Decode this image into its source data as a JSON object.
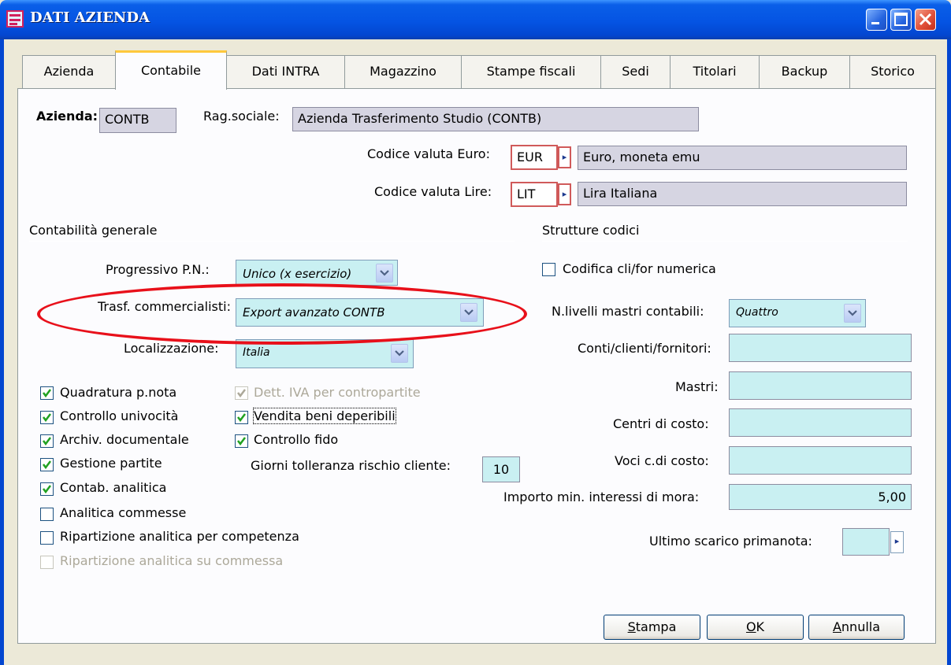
{
  "window": {
    "title": "DATI AZIENDA",
    "controls": {
      "minimize": "minimize-icon",
      "maximize": "maximize-icon",
      "close": "close-icon"
    }
  },
  "tabs": [
    "Azienda",
    "Contabile",
    "Dati INTRA",
    "Magazzino",
    "Stampe fiscali",
    "Sedi",
    "Titolari",
    "Backup",
    "Storico"
  ],
  "active_tab": "Contabile",
  "header": {
    "azienda_label": "Azienda:",
    "azienda_value": "CONTB",
    "rag_label": "Rag.sociale:",
    "rag_value": "Azienda Trasferimento Studio (CONTB)",
    "valuta_euro_label": "Codice valuta Euro:",
    "valuta_euro_code": "EUR",
    "valuta_euro_desc": "Euro, moneta emu",
    "valuta_lire_label": "Codice valuta Lire:",
    "valuta_lire_code": "LIT",
    "valuta_lire_desc": "Lira Italiana"
  },
  "contabilita": {
    "section_title": "Contabilità generale",
    "progressivo_label": "Progressivo P.N.:",
    "progressivo_value": "Unico (x esercizio)",
    "trasf_label": "Trasf. commercialisti:",
    "trasf_value": "Export avanzato CONTB",
    "localizzazione_label": "Localizzazione:",
    "localizzazione_value": "Italia",
    "checkboxes": [
      {
        "label": "Quadratura p.nota",
        "checked": true,
        "enabled": true
      },
      {
        "label": "Controllo univocità",
        "checked": true,
        "enabled": true
      },
      {
        "label": "Archiv. documentale",
        "checked": true,
        "enabled": true
      },
      {
        "label": "Gestione partite",
        "checked": true,
        "enabled": true
      },
      {
        "label": "Contab. analitica",
        "checked": true,
        "enabled": true
      },
      {
        "label": "Analitica commesse",
        "checked": false,
        "enabled": true
      },
      {
        "label": "Ripartizione analitica per competenza",
        "checked": false,
        "enabled": true
      },
      {
        "label": "Ripartizione analitica su commessa",
        "checked": false,
        "enabled": false
      }
    ],
    "checkboxes_col2": [
      {
        "label": "Dett. IVA per contropartite",
        "checked": true,
        "enabled": false
      },
      {
        "label": "Vendita beni deperibili",
        "checked": true,
        "enabled": true
      },
      {
        "label": "Controllo fido",
        "checked": true,
        "enabled": true
      }
    ],
    "giorni_label": "Giorni tolleranza rischio cliente:",
    "giorni_value": "10"
  },
  "strutture": {
    "section_title": "Strutture codici",
    "codifica_label": "Codifica cli/for numerica",
    "codifica_checked": false,
    "livelli_label": "N.livelli mastri contabili:",
    "livelli_value": "Quattro",
    "conti_label": "Conti/clienti/fornitori:",
    "conti_value": "",
    "mastri_label": "Mastri:",
    "mastri_value": "",
    "centri_label": "Centri di costo:",
    "centri_value": "",
    "voci_label": "Voci c.di costo:",
    "voci_value": "",
    "importo_label": "Importo min. interessi di mora:",
    "importo_value": "5,00",
    "ultimo_label": "Ultimo scarico primanota:",
    "ultimo_value": ""
  },
  "buttons": {
    "stampa_u": "S",
    "stampa_rest": "tampa",
    "ok_u": "O",
    "ok_rest": "K",
    "annulla_u": "A",
    "annulla_rest": "nnulla"
  },
  "colors": {
    "titlebar": "#0554e3",
    "field_cyan": "#c9f0f2",
    "field_gray": "#d6d5e2",
    "annotation_red": "#e8101a",
    "active_tab_accent": "#ffc83c"
  }
}
